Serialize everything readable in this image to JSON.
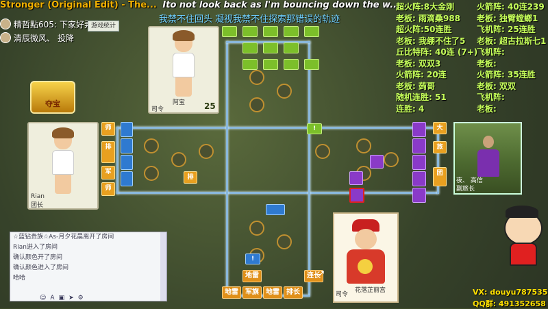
{
  "stream": {
    "marquee_title": "Stronger (Original Edit) - The...",
    "marquee_lyric": "Ito not look back as I'm bouncing down the w...",
    "subtitle": "我禁不住回头 凝视我禁不住探索那错误的轨迹"
  },
  "chat_overlay": [
    {
      "user": "精哲點605:",
      "text": "下家好弄"
    },
    {
      "user": "清辰微风、",
      "text": "投降"
    }
  ],
  "stat_button": "游戏统计",
  "treasure": "夺宝",
  "players": {
    "top": {
      "name": "阿宝",
      "title": "司令",
      "score": "25"
    },
    "left": {
      "name": "Rian",
      "title": "团长"
    },
    "right": {
      "name": "夜、 高信",
      "title": "副旅长"
    },
    "bottom": {
      "name": "花落芷丽宫",
      "title": "司令"
    }
  },
  "board": {
    "blue_labels": [
      "师",
      "排",
      "军",
      "师"
    ],
    "purple_labels": [
      "大",
      "旅",
      "团"
    ],
    "center_label": "排",
    "bottom_pieces_row1": [
      "地雷",
      "连长"
    ],
    "bottom_pieces_row2": [
      "地雷",
      "军旗",
      "地雷",
      "排长"
    ],
    "bomb_marker": "!"
  },
  "stats_col1": [
    "超火阵:8大金刚",
    "老板: 雨滴桑988",
    "超火阵:50连胜",
    "老板: 我绷不住了5",
    "丘比特阵: 40连 (7+)",
    "老板: 双双3",
    "火箭阵: 20连",
    "老板: 蒟哥",
    "随机连胜: 51",
    "连胜: 4"
  ],
  "stats_col2": [
    "火箭阵: 40连239",
    "老板: 独臂螳螂1",
    "飞机阵: 25连胜",
    "老板: 超古拉斯七1",
    "飞机阵:",
    "老板:",
    "火箭阵: 35连胜",
    "老板: 双双",
    "飞机阵:",
    "老板:"
  ],
  "chat_log": [
    "☆蓝钻贵族☆As-月夕花晨离开了房间",
    "Rian进入了房间",
    "确认颜色开了房间",
    "确认颜色进入了房间",
    "哈哈"
  ],
  "contact": {
    "vx": "VX: douyu787535",
    "qq": "QQ群: 491352658"
  },
  "colors": {
    "green": "#7cbf2a",
    "blue": "#2f7ad0",
    "purple": "#8a3ac8",
    "orange": "#e0901a"
  }
}
